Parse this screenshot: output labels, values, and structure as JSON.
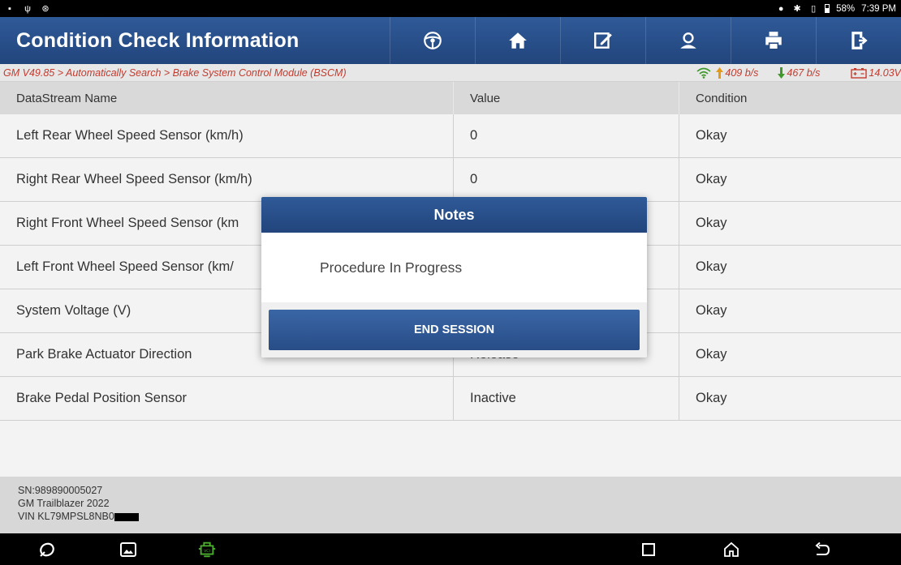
{
  "status_bar": {
    "battery": "58%",
    "time": "7:39 PM"
  },
  "header": {
    "title": "Condition Check Information",
    "toolbar": [
      "steering-wheel-icon",
      "home-icon",
      "edit-icon",
      "user-icon",
      "print-icon",
      "exit-icon"
    ]
  },
  "breadcrumb": {
    "path": "GM V49.85 > Automatically Search > Brake System Control Module (BSCM)",
    "upload": "409 b/s",
    "download": "467 b/s",
    "voltage": "14.03V"
  },
  "table": {
    "columns": [
      "DataStream Name",
      "Value",
      "Condition"
    ],
    "rows": [
      [
        "Left Rear Wheel Speed Sensor (km/h)",
        "0",
        "Okay"
      ],
      [
        "Right Rear Wheel Speed Sensor (km/h)",
        "0",
        "Okay"
      ],
      [
        "Right Front Wheel Speed Sensor (km",
        "",
        "Okay"
      ],
      [
        "Left Front Wheel Speed Sensor (km/",
        "",
        "Okay"
      ],
      [
        "System Voltage (V)",
        "",
        "Okay"
      ],
      [
        "Park Brake Actuator Direction",
        "Release",
        "Okay"
      ],
      [
        "Brake Pedal Position Sensor",
        "Inactive",
        "Okay"
      ]
    ]
  },
  "footer": {
    "sn": "SN:989890005027",
    "vehicle": "GM Trailblazer 2022",
    "vin": "VIN KL79MPSL8NB0"
  },
  "dialog": {
    "title": "Notes",
    "message": "Procedure In Progress",
    "button": "END SESSION"
  },
  "colors": {
    "header_blue": "#2a4f8c",
    "crumb_red": "#c43b2e",
    "up_arrow": "#e39a1b",
    "down_arrow": "#3f9a2b",
    "vci_green": "#4caf2e"
  }
}
